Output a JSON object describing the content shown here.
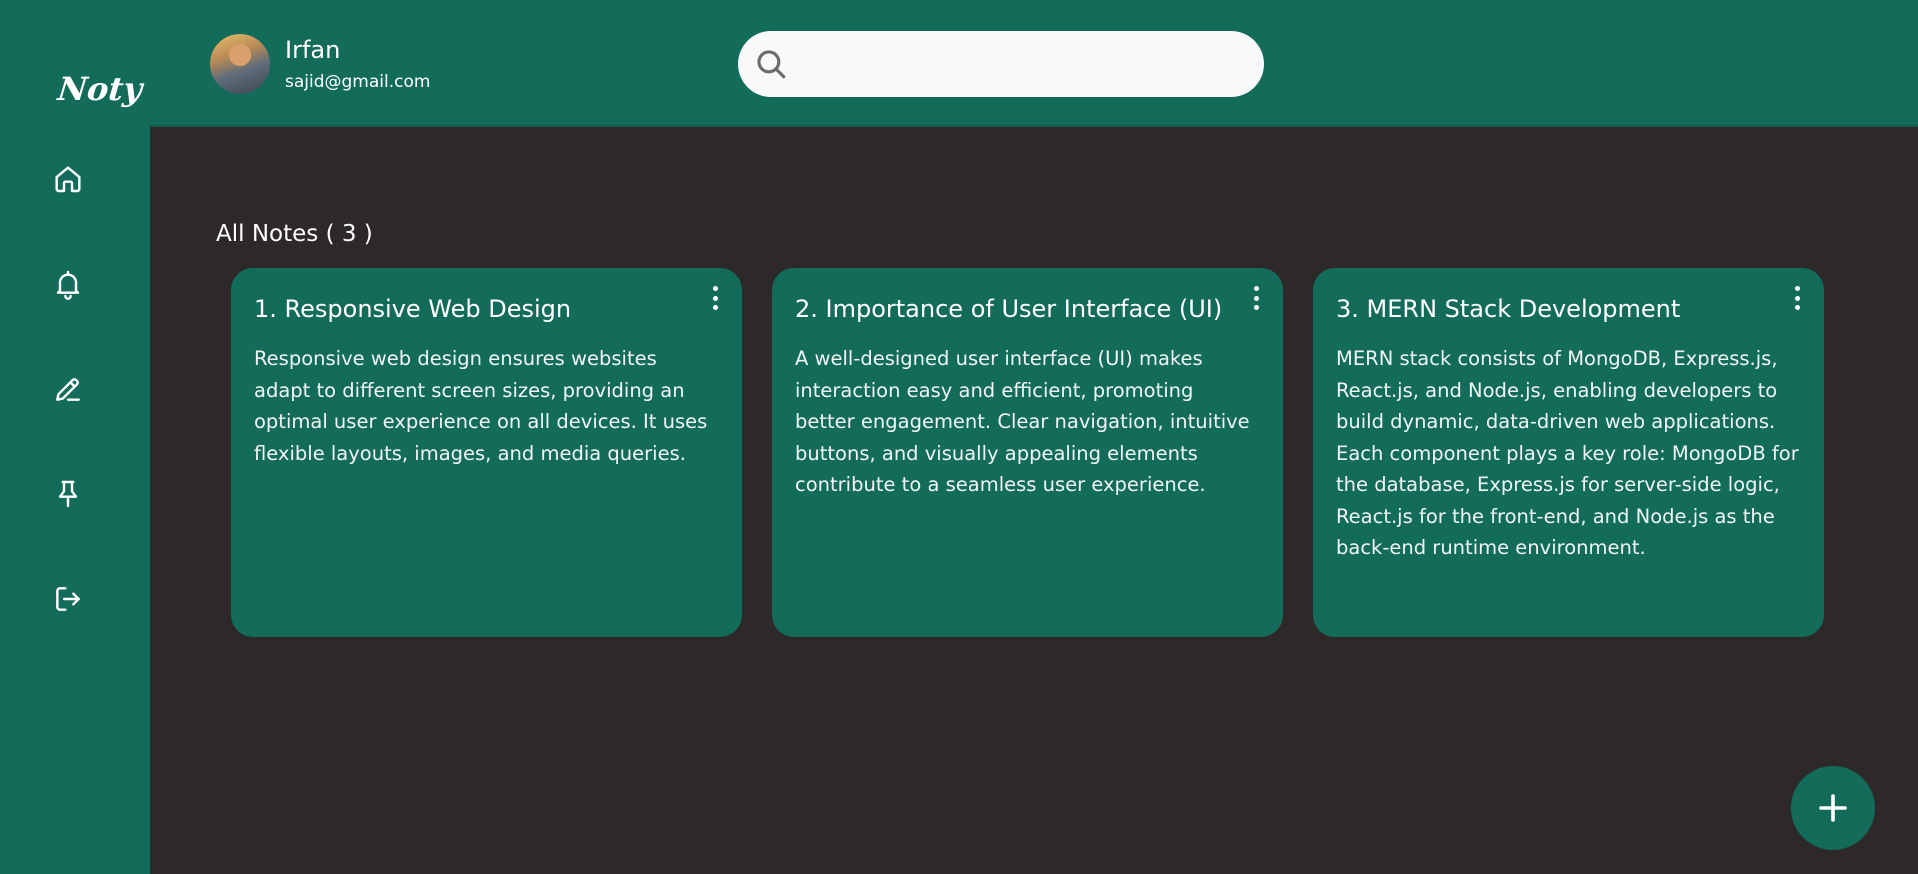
{
  "app": {
    "logo_text": "Noty"
  },
  "sidebar": {
    "items": [
      {
        "icon": "home-icon"
      },
      {
        "icon": "bell-icon"
      },
      {
        "icon": "pencil-icon"
      },
      {
        "icon": "pin-icon"
      },
      {
        "icon": "logout-icon"
      }
    ]
  },
  "header": {
    "user_name": "Irfan",
    "user_email": "sajid@gmail.com",
    "search": {
      "value": "",
      "icon": "search-icon"
    }
  },
  "main": {
    "section_title": "All Notes ( 3 )",
    "notes": [
      {
        "title": "1. Responsive Web Design",
        "body": "Responsive web design ensures websites adapt to different screen sizes, providing an optimal user experience on all devices. It uses flexible layouts, images, and media queries."
      },
      {
        "title": "2. Importance of User Interface (UI)",
        "body": "A well-designed user interface (UI) makes interaction easy and efficient, promoting better engagement. Clear navigation, intuitive buttons, and visually appealing elements contribute to a seamless user experience."
      },
      {
        "title": "3. MERN Stack Development",
        "body": "MERN stack consists of MongoDB, Express.js, React.js, and Node.js, enabling developers to build dynamic, data-driven web applications. Each component plays a key role: MongoDB for the database, Express.js for server-side logic, React.js for the front-end, and Node.js as the back-end runtime environment."
      }
    ]
  },
  "fab": {
    "icon": "plus-icon"
  },
  "colors": {
    "brand": "#136b5a",
    "background": "#2d2929",
    "search_bg": "#f8f9fb"
  }
}
